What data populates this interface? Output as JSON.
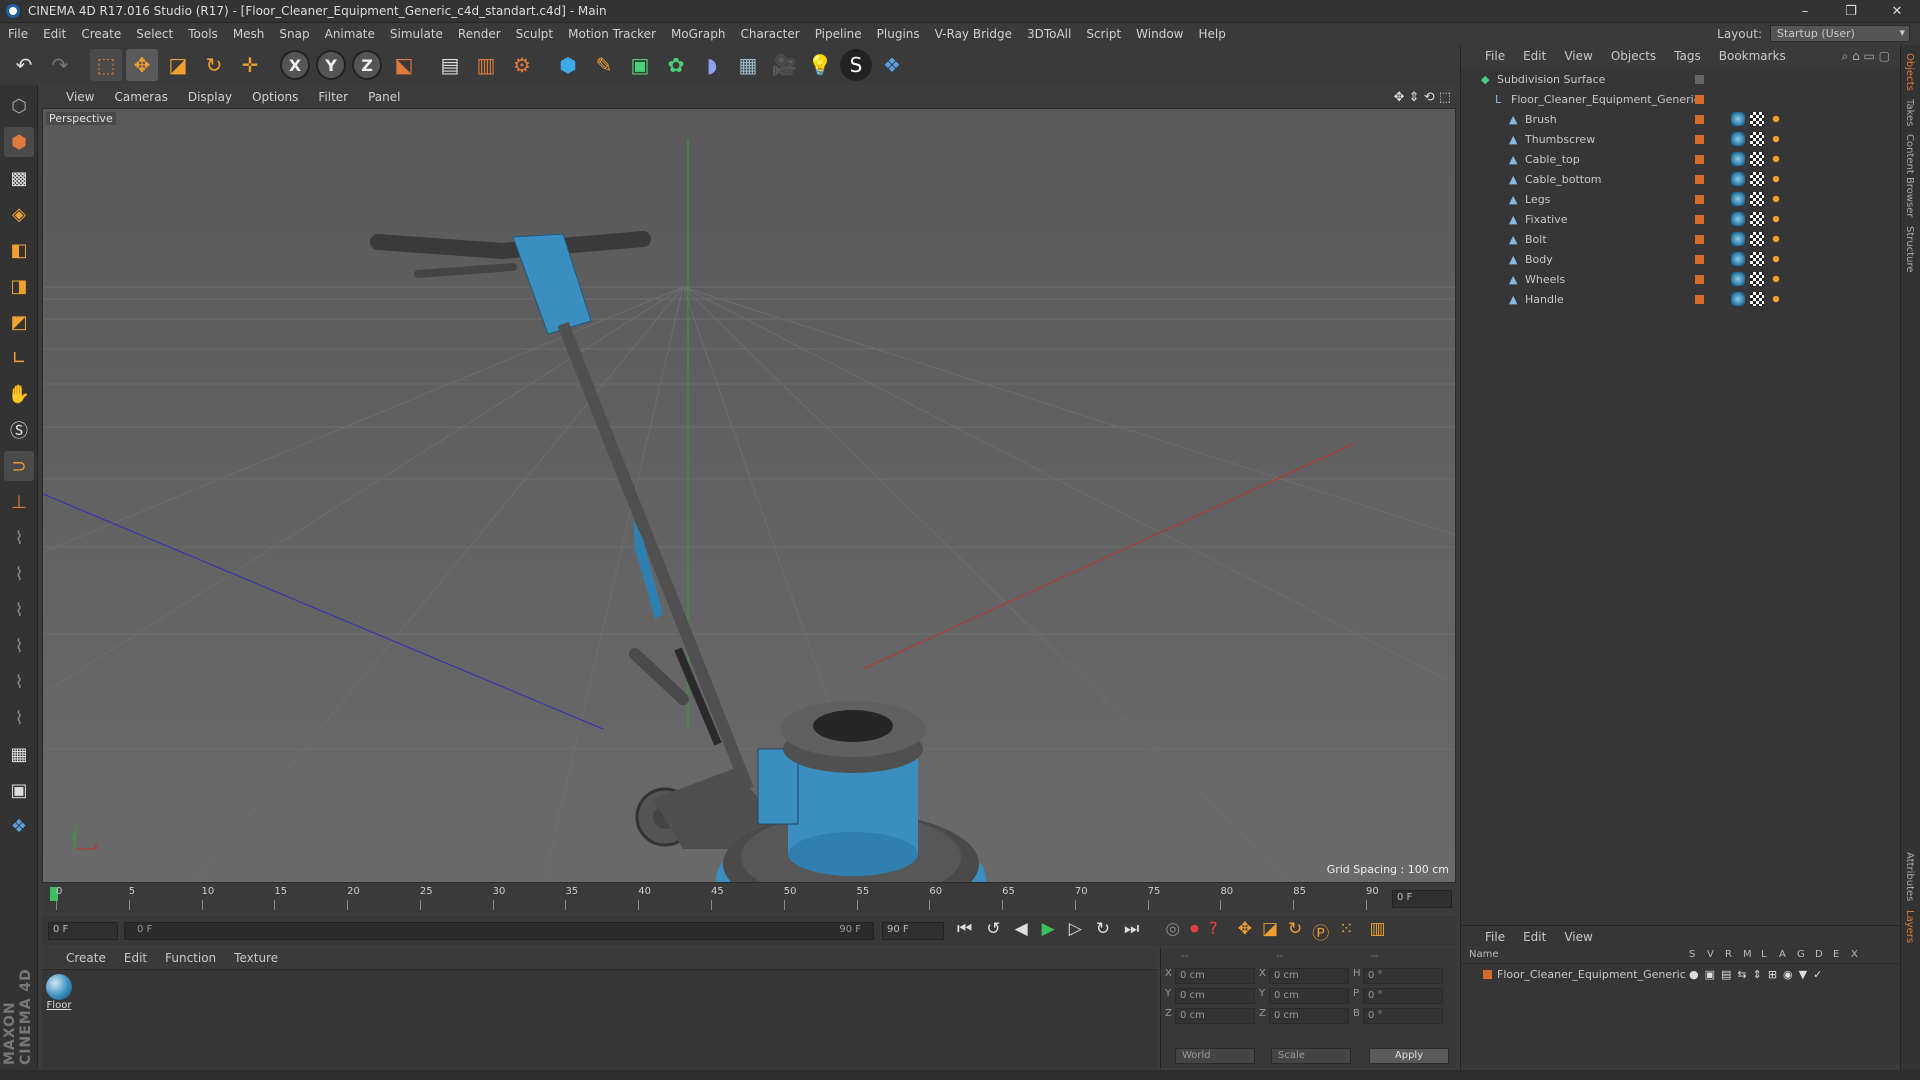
{
  "window": {
    "title": "CINEMA 4D R17.016 Studio (R17) - [Floor_Cleaner_Equipment_Generic_c4d_standart.c4d] - Main",
    "minimize": "–",
    "restore": "❐",
    "close": "✕"
  },
  "menu": [
    "File",
    "Edit",
    "Create",
    "Select",
    "Tools",
    "Mesh",
    "Snap",
    "Animate",
    "Simulate",
    "Render",
    "Sculpt",
    "Motion Tracker",
    "MoGraph",
    "Character",
    "Pipeline",
    "Plugins",
    "V-Ray Bridge",
    "3DToAll",
    "Script",
    "Window",
    "Help"
  ],
  "layout": {
    "label": "Layout:",
    "value": "Startup (User)"
  },
  "toolbar_icons": [
    "undo-icon",
    "redo-icon",
    "live-selection-icon",
    "move-icon",
    "scale-icon",
    "rotate-icon",
    "move-plus-icon",
    "x-axis-icon",
    "y-axis-icon",
    "z-axis-icon",
    "world-coord-icon",
    "render-view-icon",
    "render-picture-viewer-icon",
    "edit-render-settings-icon",
    "cube-icon",
    "pen-icon",
    "subdivision-icon",
    "mograph-cloner-icon",
    "deformer-icon",
    "floor-icon",
    "camera-icon",
    "light-icon",
    "vray-icon",
    "python-icon"
  ],
  "axis_labels": {
    "x": "X",
    "y": "Y",
    "z": "Z"
  },
  "viewport": {
    "menu": [
      "View",
      "Cameras",
      "Display",
      "Options",
      "Filter",
      "Panel"
    ],
    "label": "Perspective",
    "grid_info": "Grid Spacing : 100 cm",
    "axis_x": "x",
    "axis_y": "y"
  },
  "timeline": {
    "ticks": [
      "0",
      "5",
      "10",
      "15",
      "20",
      "25",
      "30",
      "35",
      "40",
      "45",
      "50",
      "55",
      "60",
      "65",
      "70",
      "75",
      "80",
      "85",
      "90"
    ],
    "current_frame": "0 F"
  },
  "transport": {
    "start": "0 F",
    "range_start": "0 F",
    "range_end": "90 F",
    "end": "90 F"
  },
  "material_manager": {
    "menu": [
      "Create",
      "Edit",
      "Function",
      "Texture"
    ],
    "materials": [
      {
        "name": "Floor"
      }
    ]
  },
  "coords": {
    "header": [
      "--",
      "--",
      "--"
    ],
    "rows": [
      {
        "a": "X",
        "av": "0 cm",
        "b": "X",
        "bv": "0 cm",
        "c": "H",
        "cv": "0 °"
      },
      {
        "a": "Y",
        "av": "0 cm",
        "b": "Y",
        "bv": "0 cm",
        "c": "P",
        "cv": "0 °"
      },
      {
        "a": "Z",
        "av": "0 cm",
        "b": "Z",
        "bv": "0 cm",
        "c": "B",
        "cv": "0 °"
      }
    ],
    "mode": "World",
    "scale": "Scale",
    "apply": "Apply"
  },
  "object_manager": {
    "menu": [
      "File",
      "Edit",
      "View",
      "Objects",
      "Tags",
      "Bookmarks"
    ],
    "objects": [
      {
        "name": "Subdivision Surface",
        "depth": 0
      },
      {
        "name": "Floor_Cleaner_Equipment_Generic",
        "depth": 1
      },
      {
        "name": "Brush",
        "depth": 2
      },
      {
        "name": "Thumbscrew",
        "depth": 2
      },
      {
        "name": "Cable_top",
        "depth": 2
      },
      {
        "name": "Cable_bottom",
        "depth": 2
      },
      {
        "name": "Legs",
        "depth": 2
      },
      {
        "name": "Fixative",
        "depth": 2
      },
      {
        "name": "Bolt",
        "depth": 2
      },
      {
        "name": "Body",
        "depth": 2
      },
      {
        "name": "Wheels",
        "depth": 2
      },
      {
        "name": "Handle",
        "depth": 2
      }
    ]
  },
  "layer_manager": {
    "menu": [
      "File",
      "Edit",
      "View"
    ],
    "columns": [
      "Name",
      "S",
      "V",
      "R",
      "M",
      "L",
      "A",
      "G",
      "D",
      "E",
      "X"
    ],
    "rows": [
      {
        "name": "Floor_Cleaner_Equipment_Generic"
      }
    ]
  },
  "side_tabs": [
    "Objects",
    "Takes",
    "Content Browser",
    "Structure",
    "Attributes",
    "Layers"
  ],
  "brand": "MAXON CINEMA 4D",
  "colors": {
    "accent_orange": "#d46b2a",
    "machine_blue": "#3a8fc0",
    "viewport_bg": "#5f5f5f"
  }
}
